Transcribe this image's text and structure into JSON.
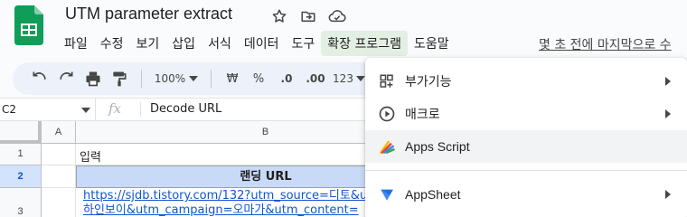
{
  "document": {
    "title": "UTM parameter extract",
    "last_edit": "몇 초 전에 마지막으로 수"
  },
  "menu": {
    "items": [
      "파일",
      "수정",
      "보기",
      "삽입",
      "서식",
      "데이터",
      "도구",
      "확장 프로그램",
      "도움말"
    ],
    "active_index": 7
  },
  "toolbar": {
    "zoom": "100%",
    "currency": "₩",
    "percent": "%",
    "decimal_decrease": ".0",
    "decimal_increase": ".00",
    "number_format": "123"
  },
  "formula_bar": {
    "cell_ref": "C2",
    "fx": "fx",
    "content": "Decode URL"
  },
  "grid": {
    "columns": [
      "A",
      "B"
    ],
    "selected_column": "C",
    "rows": [
      "1",
      "2",
      "3"
    ],
    "selected_row": "2",
    "cells": {
      "B1": "입력",
      "B2": "랜딩 URL",
      "B3_line1": "https://sjdb.tistory.com/132?utm_source=디토&ut",
      "B3_line2": "하인보이&utm_campaign=오마가&utm_content="
    }
  },
  "extensions_menu": {
    "items": [
      {
        "label": "부가기능",
        "icon": "add-ons-icon",
        "submenu": true
      },
      {
        "label": "매크로",
        "icon": "macro-play-icon",
        "submenu": true
      },
      {
        "label": "Apps Script",
        "icon": "apps-script-icon",
        "submenu": false
      },
      {
        "label": "AppSheet",
        "icon": "appsheet-icon",
        "submenu": true
      }
    ]
  },
  "colors": {
    "sheets_green": "#0f9d58",
    "active_menu_bg": "#e3efe2",
    "header_cell_bg": "#c9daf8",
    "link": "#1155cc",
    "selected_header": "#d3e3fd"
  }
}
